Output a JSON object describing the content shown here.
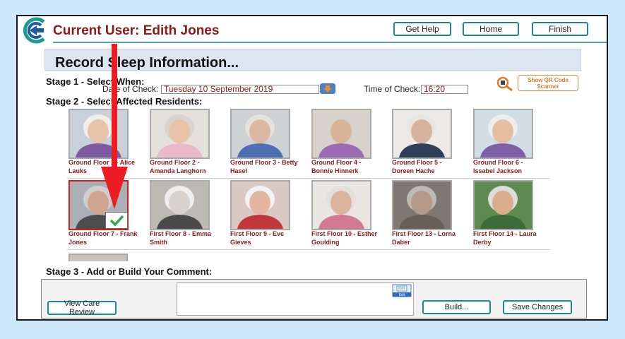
{
  "header": {
    "title": "Current User: Edith Jones",
    "buttons": {
      "help": "Get Help",
      "home": "Home",
      "finish": "Finish"
    }
  },
  "page_title": "Record Sleep Information...",
  "stage1": {
    "heading": "Stage 1 - Select When:",
    "date_label": "Date of Check:",
    "date_value": "Tuesday 10 September 2019",
    "time_label": "Time of Check:",
    "time_value": "16:20",
    "qr_label": "Show QR Code Scanner"
  },
  "stage2": {
    "heading": "Stage 2 - Select Affected Residents:"
  },
  "residents": [
    {
      "name": "Ground Floor 1 - Alice Lauks",
      "selected": false,
      "skin": "#e7c3aa",
      "hair": "#f1efe9",
      "clothes": "#7d5aa0",
      "bg": "#c9d0d8"
    },
    {
      "name": "Ground Floor 2 - Amanda Langhorn",
      "selected": false,
      "skin": "#e9c1a6",
      "hair": "#d8d3cc",
      "clothes": "#e8b9c9",
      "bg": "#e4e1dc"
    },
    {
      "name": "Ground Floor 3 - Betty Hasel",
      "selected": false,
      "skin": "#dcb8a0",
      "hair": "#e6e3df",
      "clothes": "#4b6fb0",
      "bg": "#cfd2d4"
    },
    {
      "name": "Ground Floor 4 - Bonnie Hinnerk",
      "selected": false,
      "skin": "#dab397",
      "hair": "#d6d2cd",
      "clothes": "#9b6bb3",
      "bg": "#d8d2cc"
    },
    {
      "name": "Ground Floor 5 - Doreen Hache",
      "selected": false,
      "skin": "#d6b39c",
      "hair": "#e8e6e2",
      "clothes": "#2f3f57",
      "bg": "#eceae7"
    },
    {
      "name": "Ground Floor 6 - Issabel Jackson",
      "selected": false,
      "skin": "#e5be9f",
      "hair": "#eeeeee",
      "clothes": "#7e5fa8",
      "bg": "#d2dde6"
    },
    {
      "name": "Ground Floor 7 - Frank Jones",
      "selected": true,
      "skin": "#d0a58d",
      "hair": "#cfcfcf",
      "clothes": "#4d4d4d",
      "bg": "#aab0b6"
    },
    {
      "name": "First Floor 8 - Emma Smith",
      "selected": false,
      "skin": "#d7d2cd",
      "hair": "#eeeeee",
      "clothes": "#4a4a4a",
      "bg": "#bdb9b5"
    },
    {
      "name": "First Floor 9 - Eve Gieves",
      "selected": false,
      "skin": "#e4b6a0",
      "hair": "#f3f3f3",
      "clothes": "#c2373a",
      "bg": "#d9c9c2"
    },
    {
      "name": "First Floor 10 - Esther Goulding",
      "selected": false,
      "skin": "#dcb49c",
      "hair": "#e3dfda",
      "clothes": "#d37a93",
      "bg": "#eae6e1"
    },
    {
      "name": "First Floor 13 - Lorna Daber",
      "selected": false,
      "skin": "#b39a89",
      "hair": "#bdbab6",
      "clothes": "#6a5f57",
      "bg": "#7f7771"
    },
    {
      "name": "First Floor 14 - Laura Derby",
      "selected": false,
      "skin": "#d9ae8d",
      "hair": "#dcdcdc",
      "clothes": "#3d6b3a",
      "bg": "#5e8a4f"
    }
  ],
  "stage3": {
    "heading": "Stage 3 - Add or Build Your Comment:",
    "comment": "",
    "edit_label": "Edit",
    "care_review": "View Care Review",
    "build": "Build...",
    "save": "Save Changes"
  },
  "colors": {
    "accent": "#8b1a1a",
    "button_border": "#1f8a8a",
    "selection": "#d91a1a",
    "arrow": "#ec1c24"
  }
}
